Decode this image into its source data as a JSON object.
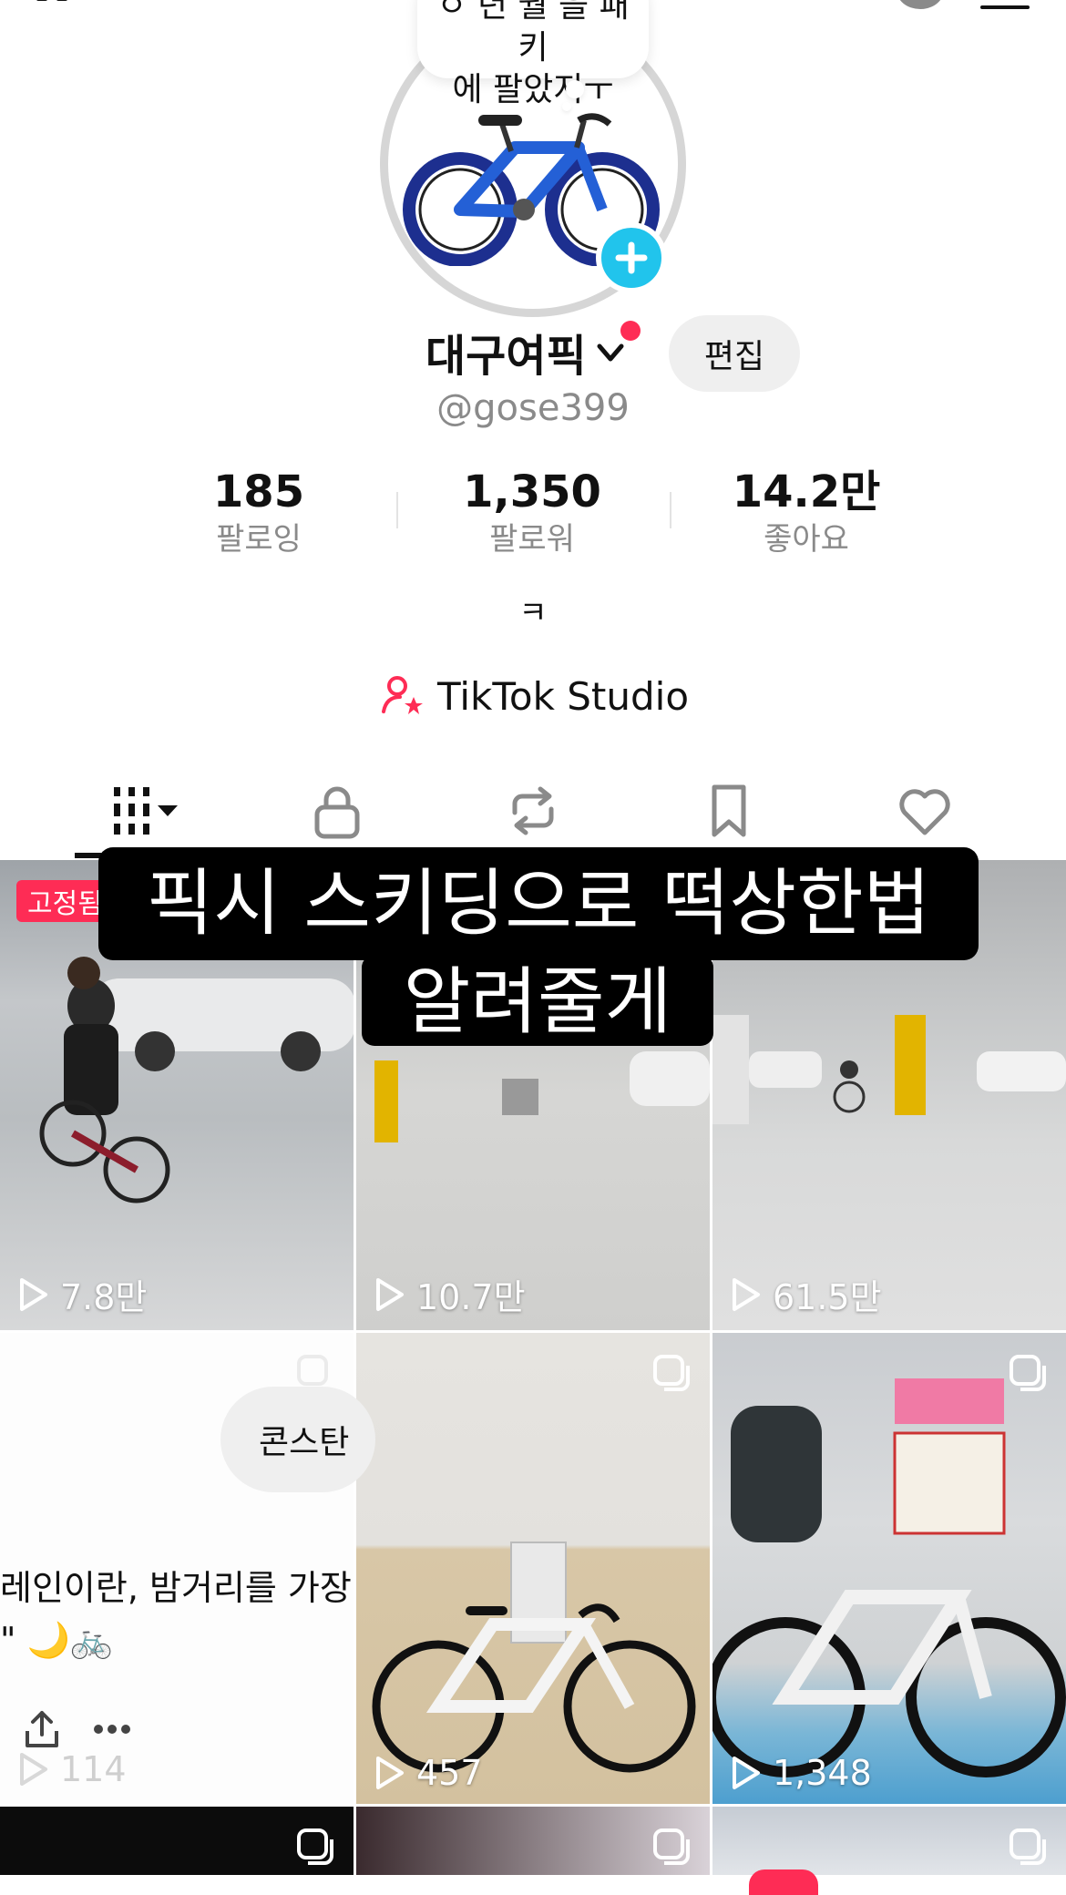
{
  "profile": {
    "note": "생 년 월 을 패 키 에 팔았지ㅜ",
    "note_line1": "ㅇ 년 월 을 패 키",
    "note_line2": "에 팔았지ㅜ",
    "display_name": "대구여픽",
    "username": "@gose399",
    "edit_label": "편집",
    "bio": "ㅋ",
    "studio_label": "TikTok Studio"
  },
  "stats": [
    {
      "value": "185",
      "label": "팔로잉"
    },
    {
      "value": "1,350",
      "label": "팔로워"
    },
    {
      "value": "14.2만",
      "label": "좋아요"
    }
  ],
  "tabs": [
    {
      "name": "videos",
      "icon": "grid-filter-icon",
      "active": true
    },
    {
      "name": "private",
      "icon": "lock-icon"
    },
    {
      "name": "reposts",
      "icon": "repost-icon"
    },
    {
      "name": "favorites",
      "icon": "bookmark-icon"
    },
    {
      "name": "liked",
      "icon": "heart-icon"
    }
  ],
  "grid": {
    "pinned_badge": "고정됨",
    "caption_line1": "픽시 스키딩으로 떡상한법",
    "caption_line2": "알려줄게",
    "views": [
      "7.8만",
      "10.7만",
      "61.5만",
      "114",
      "457",
      "1,348"
    ],
    "chat_bubble": "콘스탄",
    "post_text": "레인이란, 밤거리를 가장 아",
    "post_emoji": "\" 🌙🚲"
  },
  "colors": {
    "accent_red": "#fe2c55",
    "add_blue": "#21c4ec"
  }
}
